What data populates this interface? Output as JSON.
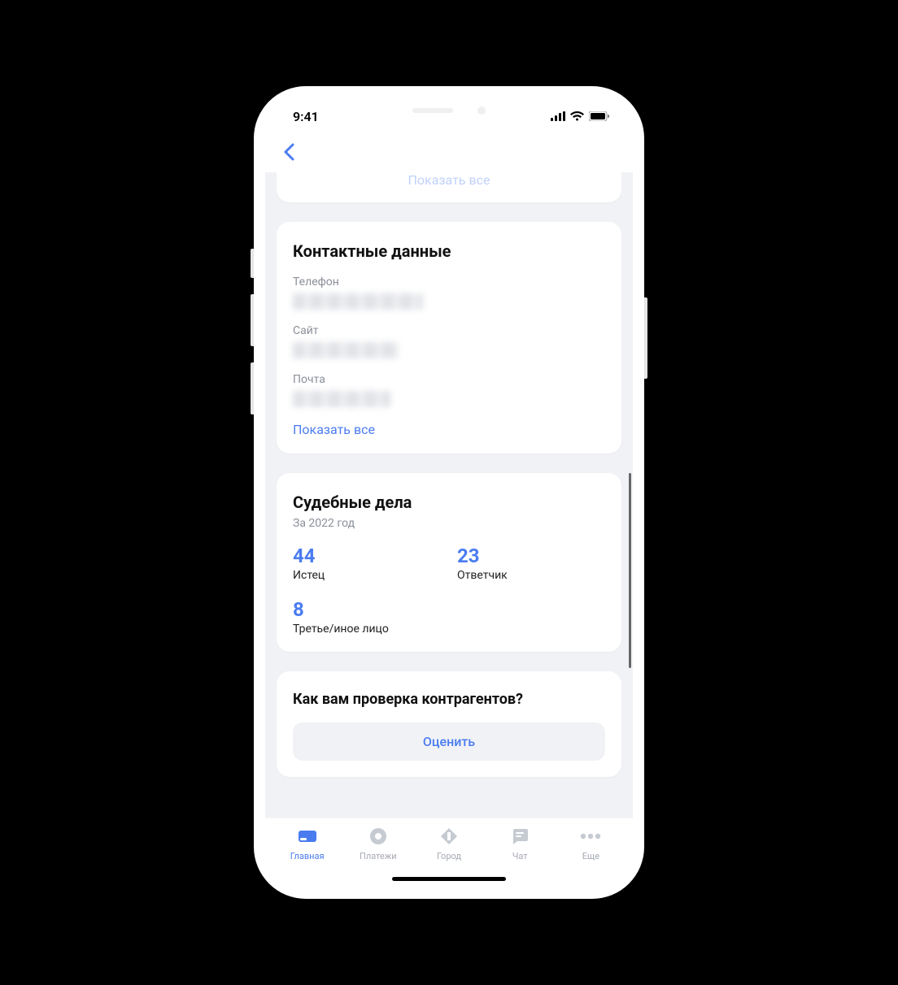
{
  "status": {
    "time": "9:41"
  },
  "top_link": "Показать все",
  "contact": {
    "title": "Контактные данные",
    "phone_label": "Телефон",
    "site_label": "Сайт",
    "email_label": "Почта",
    "show_all": "Показать все"
  },
  "cases": {
    "title": "Судебные дела",
    "subtitle": "За 2022 год",
    "plaintiff": {
      "value": "44",
      "label": "Истец"
    },
    "defendant": {
      "value": "23",
      "label": "Ответчик"
    },
    "third": {
      "value": "8",
      "label": "Третье/иное лицо"
    }
  },
  "feedback": {
    "title": "Как вам проверка контрагентов?",
    "button": "Оценить"
  },
  "tabs": {
    "home": "Главная",
    "payments": "Платежи",
    "city": "Город",
    "chat": "Чат",
    "more": "Еще"
  }
}
